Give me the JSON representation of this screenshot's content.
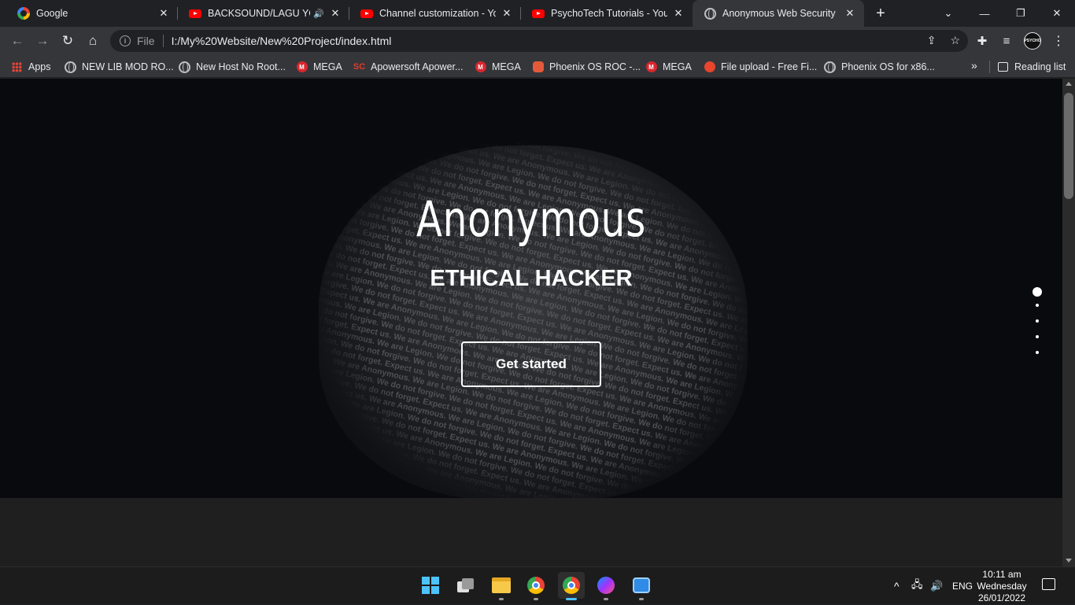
{
  "browser": {
    "tabs": [
      {
        "title": "Google",
        "favicon": "google-icon",
        "active": false
      },
      {
        "title": "BACKSOUND/LAGU YOU",
        "favicon": "youtube-icon",
        "audio": true,
        "active": false
      },
      {
        "title": "Channel customization - You",
        "favicon": "youtube-icon",
        "active": false
      },
      {
        "title": "PsychoTech Tutorials - YouTu",
        "favicon": "youtube-icon",
        "active": false
      },
      {
        "title": "Anonymous Web Security",
        "favicon": "globe-icon",
        "active": true
      }
    ],
    "close_glyph": "✕",
    "new_tab_glyph": "+",
    "window_controls": {
      "dropdown": "⌄",
      "minimize": "—",
      "maximize": "❐",
      "close": "✕"
    },
    "address_bar": {
      "scheme_label": "File",
      "url": "I:/My%20Website/New%20Project/index.html"
    },
    "profile_label": "PSYCHO",
    "bookmarks": [
      {
        "label": "Apps",
        "icon": "apps-icon"
      },
      {
        "label": "NEW LIB MOD RO...",
        "icon": "globe-icon"
      },
      {
        "label": "New Host No Root...",
        "icon": "globe-icon"
      },
      {
        "label": "MEGA",
        "icon": "mega-icon"
      },
      {
        "label": "Apowersoft Apower...",
        "icon": "apowersoft-icon"
      },
      {
        "label": "MEGA",
        "icon": "mega-icon"
      },
      {
        "label": "Phoenix OS ROC -...",
        "icon": "phoenix-icon"
      },
      {
        "label": "MEGA",
        "icon": "mega-icon"
      },
      {
        "label": "File upload - Free Fi...",
        "icon": "upload-icon"
      },
      {
        "label": "Phoenix OS for x86...",
        "icon": "globe-icon"
      }
    ],
    "bookmarks_overflow": "»",
    "reading_list_label": "Reading list"
  },
  "page": {
    "hero_title": "Anonymous",
    "hero_subtitle": "ETHICAL HACKER",
    "cta_label": "Get started",
    "mask_text": "We are Anonymous. We are Legion. We do not forgive. We do not forget. Expect us.",
    "slide_dots": {
      "count": 5,
      "active_index": 0
    }
  },
  "taskbar": {
    "apps": [
      {
        "name": "start",
        "running": false
      },
      {
        "name": "task-view",
        "running": false
      },
      {
        "name": "file-explorer",
        "running": true
      },
      {
        "name": "chrome",
        "running": true
      },
      {
        "name": "chrome-profile",
        "running": true,
        "focused": true
      },
      {
        "name": "messenger",
        "running": true
      },
      {
        "name": "meet-now",
        "running": true
      }
    ],
    "tray": {
      "chevron": "^",
      "language": "ENG",
      "time": "10:11 am",
      "day": "Wednesday",
      "date": "26/01/2022"
    }
  },
  "colors": {
    "accent": "#4cc2ff",
    "hero_background": "#080a0d",
    "chrome_tab_active": "#35363a"
  }
}
